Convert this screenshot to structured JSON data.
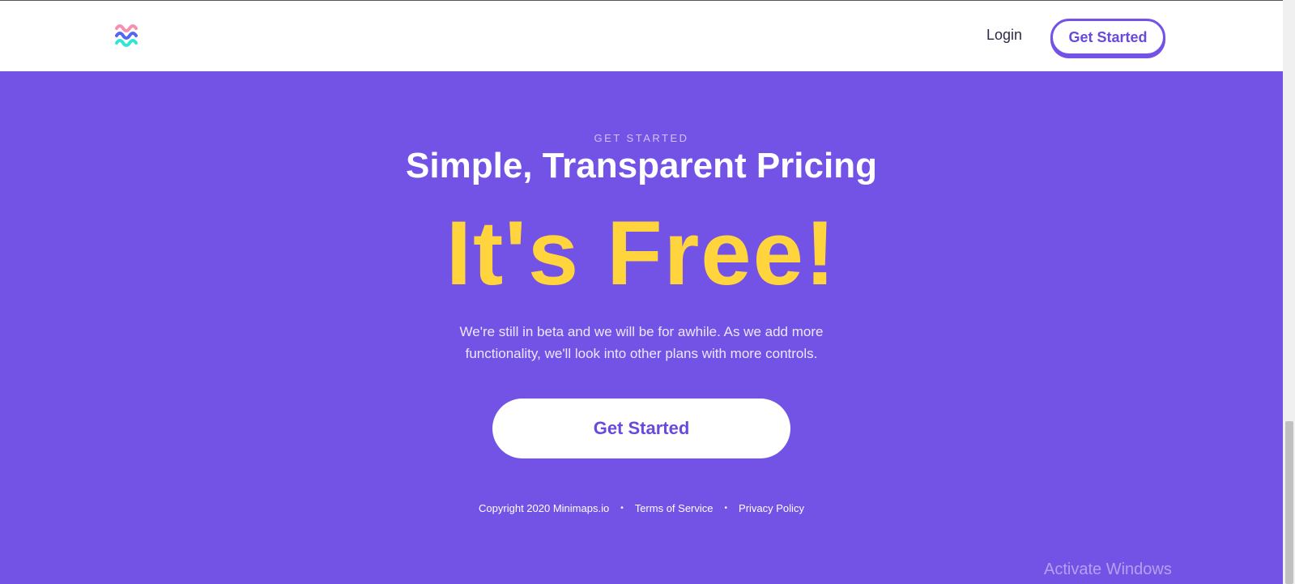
{
  "header": {
    "login_label": "Login",
    "get_started_label": "Get Started",
    "logo_colors": [
      "#f88fb0",
      "#5566f0",
      "#2ee8d5"
    ]
  },
  "hero": {
    "eyebrow": "GET STARTED",
    "title": "Simple, Transparent Pricing",
    "free_text": "It's Free!",
    "description": "We're still in beta and we will be for awhile. As we add more functionality, we'll look into other plans with more controls.",
    "cta_label": "Get Started"
  },
  "footer": {
    "copyright": "Copyright 2020 Minimaps.io",
    "separator": "•",
    "terms": "Terms of Service",
    "privacy": "Privacy Policy"
  },
  "os_overlay": {
    "watermark": "Activate Windows"
  },
  "colors": {
    "brand_purple": "#7352e6",
    "accent_yellow": "#ffd43d",
    "white": "#ffffff"
  }
}
